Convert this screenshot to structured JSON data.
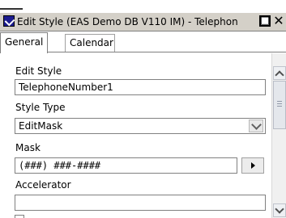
{
  "window": {
    "title": "Edit Style (EAS Demo DB V110 IM) - Telephon",
    "icons": {
      "app": "edit-style-icon",
      "maximize": "maximize-icon",
      "close": "close-icon"
    },
    "maximize_glyph": "□",
    "close_glyph": "✕"
  },
  "tabs": [
    {
      "label": "General",
      "active": true
    },
    {
      "label": "Calendar",
      "active": false
    }
  ],
  "form": {
    "edit_style": {
      "label": "Edit Style",
      "value": "TelephoneNumber1"
    },
    "style_type": {
      "label": "Style Type",
      "value": "EditMask"
    },
    "mask": {
      "label": "Mask",
      "value": "(###) ###-####"
    },
    "accelerator": {
      "label": "Accelerator",
      "value": ""
    }
  },
  "colors": {
    "titlebar": "#d4d0c8",
    "background": "#ffffff",
    "border": "#808080"
  }
}
